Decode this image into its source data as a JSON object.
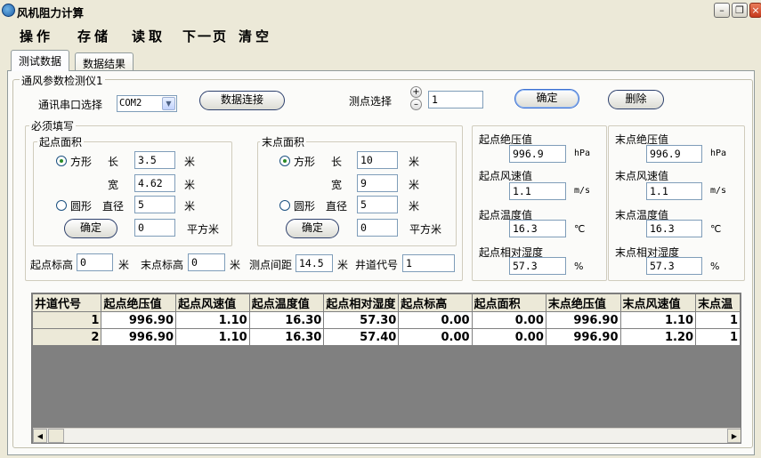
{
  "window": {
    "title": "风机阻力计算"
  },
  "menu": [
    "操作",
    "存储",
    "读取",
    "下一页",
    "清空"
  ],
  "tabs": [
    "测试数据",
    "数据结果"
  ],
  "group_title": "通风参数检测仪1",
  "serial": {
    "label": "通讯串口选择",
    "value": "COM2",
    "connect_button": "数据连接"
  },
  "point_select": {
    "label": "测点选择",
    "value": "1",
    "confirm_button": "确定",
    "delete_button": "删除"
  },
  "required_title": "必须填写",
  "start_area": {
    "title": "起点面积",
    "square_label": "方形",
    "length_label": "长",
    "length": "3.5",
    "width_label": "宽",
    "width": "4.62",
    "circle_label": "圆形",
    "diameter_label": "直径",
    "diameter": "5",
    "unit_m": "米",
    "confirm": "确定",
    "area": "0",
    "area_unit": "平方米",
    "selected": "square"
  },
  "end_area": {
    "title": "末点面积",
    "square_label": "方形",
    "length_label": "长",
    "length": "10",
    "width_label": "宽",
    "width": "9",
    "circle_label": "圆形",
    "diameter_label": "直径",
    "diameter": "5",
    "unit_m": "米",
    "confirm": "确定",
    "area": "0",
    "area_unit": "平方米",
    "selected": "square"
  },
  "bottom_row": {
    "start_elev_label": "起点标高",
    "start_elev": "0",
    "unit_m": "米",
    "end_elev_label": "末点标高",
    "end_elev": "0",
    "spacing_label": "测点间距",
    "spacing": "14.5",
    "well_label": "井道代号",
    "well": "1"
  },
  "start_readings": {
    "pressure_label": "起点绝压值",
    "pressure": "996.9",
    "pressure_unit": "hPa",
    "wind_label": "起点风速值",
    "wind": "1.1",
    "wind_unit": "m/s",
    "temp_label": "起点温度值",
    "temp": "16.3",
    "temp_unit": "℃",
    "humidity_label": "起点相对湿度",
    "humidity": "57.3",
    "humidity_unit": "%"
  },
  "end_readings": {
    "pressure_label": "末点绝压值",
    "pressure": "996.9",
    "pressure_unit": "hPa",
    "wind_label": "末点风速值",
    "wind": "1.1",
    "wind_unit": "m/s",
    "temp_label": "末点温度值",
    "temp": "16.3",
    "temp_unit": "℃",
    "humidity_label": "末点相对湿度",
    "humidity": "57.3",
    "humidity_unit": "%"
  },
  "table": {
    "columns": [
      "井道代号",
      "起点绝压值",
      "起点风速值",
      "起点温度值",
      "起点相对湿度",
      "起点标高",
      "起点面积",
      "末点绝压值",
      "末点风速值",
      "末点温"
    ],
    "rows": [
      [
        "1",
        "996.90",
        "1.10",
        "16.30",
        "57.30",
        "0.00",
        "0.00",
        "996.90",
        "1.10",
        "1"
      ],
      [
        "2",
        "996.90",
        "1.10",
        "16.30",
        "57.40",
        "0.00",
        "0.00",
        "996.90",
        "1.20",
        "1"
      ]
    ]
  }
}
